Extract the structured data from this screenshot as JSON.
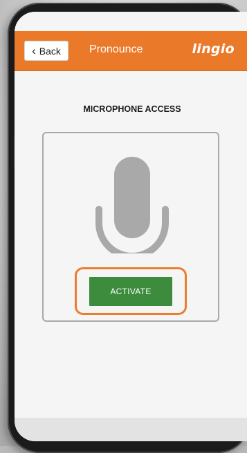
{
  "header": {
    "back_label": "Back",
    "title": "Pronounce",
    "logo_text": "lingio"
  },
  "main": {
    "section_title": "MICROPHONE ACCESS",
    "activate_label": "ACTIVATE"
  },
  "colors": {
    "header": "#ea7a2a",
    "activate_button": "#3d8b3d",
    "highlight_outline": "#ee7b2f",
    "microphone": "#a9a9a9"
  },
  "icons": [
    "chevron-left-icon",
    "microphone-icon"
  ]
}
